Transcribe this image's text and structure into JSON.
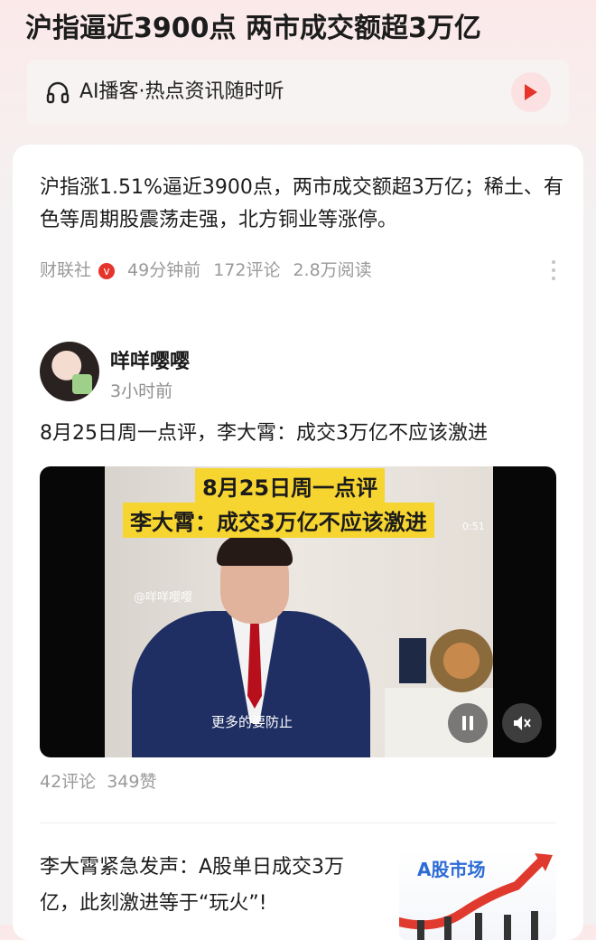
{
  "header": {
    "title": "沪指逼近3900点 两市成交额超3万亿"
  },
  "podcast": {
    "label": "AI播客·热点资讯随时听",
    "icon": "headphones-icon",
    "play_icon": "play-icon",
    "accent": "#e5342b"
  },
  "news1": {
    "text": "沪指涨1.51%逼近3900点，两市成交额超3万亿；稀土、有色等周期股震荡走强，北方铜业等涨停。",
    "source": "财联社",
    "verified_mark": "v",
    "time": "49分钟前",
    "comments": "172评论",
    "reads": "2.8万阅读"
  },
  "post": {
    "author": "咩咩嘤嘤",
    "time": "3小时前",
    "title": "8月25日周一点评，李大霄：成交3万亿不应该激进",
    "video": {
      "caption_line1": "8月25日周一点评",
      "caption_line2": "李大霄：成交3万亿不应该激进",
      "time_code": "0:51",
      "watermark": "@咩咩嘤嘤",
      "subtitle": "更多的要防止"
    },
    "comments": "42评论",
    "likes": "349赞"
  },
  "news3": {
    "text": "李大霄紧急发声：A股单日成交3万亿，此刻激进等于“玩火”!",
    "thumb_title": "A股市场"
  }
}
